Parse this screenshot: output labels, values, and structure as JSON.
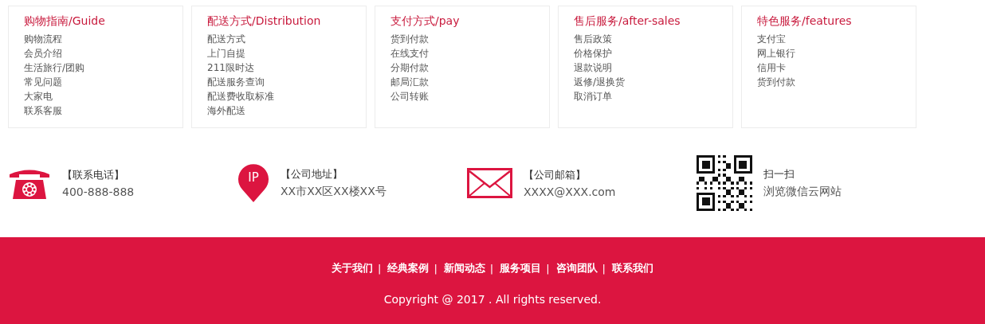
{
  "columns": [
    {
      "title": "购物指南/Guide",
      "items": [
        "购物流程",
        "会员介绍",
        "生活旅行/团购",
        "常见问题",
        "大家电",
        "联系客服"
      ]
    },
    {
      "title": "配送方式/Distribution",
      "items": [
        "配送方式",
        "上门自提",
        "211限时达",
        "配送服务查询",
        "配送费收取标准",
        "海外配送"
      ]
    },
    {
      "title": "支付方式/pay",
      "items": [
        "货到付款",
        "在线支付",
        "分期付款",
        "邮局汇款",
        "公司转账"
      ]
    },
    {
      "title": "售后服务/after-sales",
      "items": [
        "售后政策",
        "价格保护",
        "退款说明",
        "返修/退换货",
        "取消订单"
      ]
    },
    {
      "title": "特色服务/features",
      "items": [
        "支付宝",
        "网上银行",
        "信用卡",
        "货到付款"
      ]
    }
  ],
  "contacts": [
    {
      "kind": "phone",
      "label": "【联系电话】",
      "value": "400-888-888"
    },
    {
      "kind": "pin",
      "badge": "IP",
      "label": "【公司地址】",
      "value": "XX市XX区XX楼XX号"
    },
    {
      "kind": "mail",
      "label": "【公司邮箱】",
      "value": "XXXX@XXX.com"
    },
    {
      "kind": "qr",
      "label": "扫一扫",
      "value": "浏览微信云网站"
    }
  ],
  "footer": {
    "links": [
      {
        "label": "关于我们",
        "separator": "|"
      },
      {
        "label": "经典案例",
        "separator": "|"
      },
      {
        "label": "新闻动态",
        "separator": "|"
      },
      {
        "label": "服务项目",
        "separator": "|"
      },
      {
        "label": "咨询团队",
        "separator": "|"
      },
      {
        "label": "联系我们"
      }
    ],
    "copyright": "Copyright @ 2017 . All rights reserved."
  }
}
